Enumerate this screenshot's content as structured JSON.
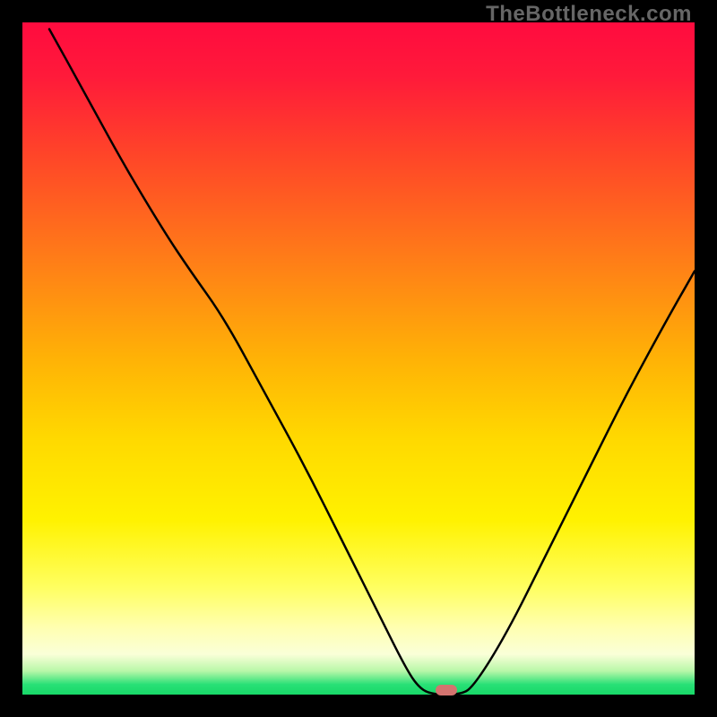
{
  "watermark": "TheBottleneck.com",
  "colors": {
    "background": "#000000",
    "curve": "#000000",
    "marker": "#d4736f",
    "gradient_stops": [
      {
        "offset": 0.0,
        "color": "#ff0b3f"
      },
      {
        "offset": 0.08,
        "color": "#ff1a3a"
      },
      {
        "offset": 0.2,
        "color": "#ff4628"
      },
      {
        "offset": 0.35,
        "color": "#ff7c18"
      },
      {
        "offset": 0.5,
        "color": "#ffb206"
      },
      {
        "offset": 0.62,
        "color": "#ffd900"
      },
      {
        "offset": 0.74,
        "color": "#fff200"
      },
      {
        "offset": 0.84,
        "color": "#ffff60"
      },
      {
        "offset": 0.9,
        "color": "#ffffb0"
      },
      {
        "offset": 0.94,
        "color": "#faffd8"
      },
      {
        "offset": 0.965,
        "color": "#b8f7a8"
      },
      {
        "offset": 0.985,
        "color": "#28e076"
      },
      {
        "offset": 1.0,
        "color": "#18d868"
      }
    ]
  },
  "chart_data": {
    "type": "line",
    "title": "",
    "xlabel": "",
    "ylabel": "",
    "xlim": [
      0,
      100
    ],
    "ylim": [
      0,
      100
    ],
    "marker": {
      "x": 63,
      "y": 0
    },
    "series": [
      {
        "name": "bottleneck-curve",
        "points": [
          {
            "x": 4,
            "y": 99
          },
          {
            "x": 9,
            "y": 90
          },
          {
            "x": 15,
            "y": 79
          },
          {
            "x": 21,
            "y": 69
          },
          {
            "x": 25,
            "y": 63
          },
          {
            "x": 30,
            "y": 56
          },
          {
            "x": 36,
            "y": 45
          },
          {
            "x": 42,
            "y": 34
          },
          {
            "x": 48,
            "y": 22
          },
          {
            "x": 53,
            "y": 12
          },
          {
            "x": 57,
            "y": 4
          },
          {
            "x": 59,
            "y": 1
          },
          {
            "x": 61,
            "y": 0
          },
          {
            "x": 65,
            "y": 0
          },
          {
            "x": 67,
            "y": 1
          },
          {
            "x": 72,
            "y": 9
          },
          {
            "x": 78,
            "y": 21
          },
          {
            "x": 84,
            "y": 33
          },
          {
            "x": 90,
            "y": 45
          },
          {
            "x": 96,
            "y": 56
          },
          {
            "x": 100,
            "y": 63
          }
        ]
      }
    ]
  }
}
